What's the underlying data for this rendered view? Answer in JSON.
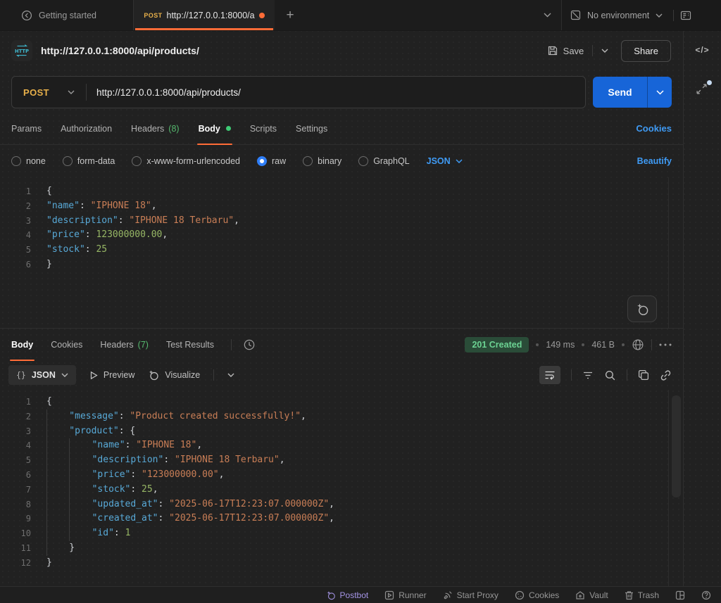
{
  "topbar": {
    "tab_getting_started": "Getting started",
    "active_tab": {
      "method": "POST",
      "title": "http://127.0.0.1:8000/a"
    },
    "new_tab": "+",
    "environment": "No environment"
  },
  "request_header": {
    "title": "http://127.0.0.1:8000/api/products/",
    "save": "Save",
    "share": "Share",
    "code_icon": "</>"
  },
  "url_bar": {
    "method": "POST",
    "url": "http://127.0.0.1:8000/api/products/",
    "send": "Send"
  },
  "request_tabs": {
    "items": [
      {
        "label": "Params"
      },
      {
        "label": "Authorization"
      },
      {
        "label": "Headers",
        "count": "(8)"
      },
      {
        "label": "Body",
        "active": true,
        "dot": true
      },
      {
        "label": "Scripts"
      },
      {
        "label": "Settings"
      }
    ],
    "cookies_link": "Cookies"
  },
  "body_modes": {
    "options": [
      {
        "label": "none"
      },
      {
        "label": "form-data"
      },
      {
        "label": "x-www-form-urlencoded"
      },
      {
        "label": "raw",
        "selected": true
      },
      {
        "label": "binary"
      },
      {
        "label": "GraphQL"
      }
    ],
    "language": "JSON",
    "beautify": "Beautify"
  },
  "request_body": {
    "lines": [
      {
        "ind": 0,
        "tok": [
          [
            "p",
            "{"
          ]
        ]
      },
      {
        "ind": 0,
        "tok": [
          [
            "k",
            "\"name\""
          ],
          [
            "p",
            ": "
          ],
          [
            "s",
            "\"IPHONE 18\""
          ],
          [
            "p",
            ","
          ]
        ]
      },
      {
        "ind": 0,
        "tok": [
          [
            "k",
            "\"description\""
          ],
          [
            "p",
            ": "
          ],
          [
            "s",
            "\"IPHONE 18 Terbaru\""
          ],
          [
            "p",
            ","
          ]
        ]
      },
      {
        "ind": 0,
        "tok": [
          [
            "k",
            "\"price\""
          ],
          [
            "p",
            ": "
          ],
          [
            "n",
            "123000000.00"
          ],
          [
            "p",
            ","
          ]
        ]
      },
      {
        "ind": 0,
        "tok": [
          [
            "k",
            "\"stock\""
          ],
          [
            "p",
            ": "
          ],
          [
            "n",
            "25"
          ]
        ]
      },
      {
        "ind": 0,
        "tok": [
          [
            "p",
            "}"
          ]
        ]
      }
    ]
  },
  "response": {
    "tabs": [
      {
        "label": "Body",
        "active": true
      },
      {
        "label": "Cookies"
      },
      {
        "label": "Headers",
        "count": "(7)"
      },
      {
        "label": "Test Results"
      }
    ],
    "status_badge": "201 Created",
    "time": "149 ms",
    "size": "461 B",
    "view": {
      "brace": "{}",
      "label": "JSON"
    },
    "preview": "Preview",
    "visualize": "Visualize",
    "lines": [
      {
        "ind": 0,
        "tok": [
          [
            "p",
            "{"
          ]
        ]
      },
      {
        "ind": 1,
        "tok": [
          [
            "k",
            "\"message\""
          ],
          [
            "p",
            ": "
          ],
          [
            "s",
            "\"Product created successfully!\""
          ],
          [
            "p",
            ","
          ]
        ]
      },
      {
        "ind": 1,
        "tok": [
          [
            "k",
            "\"product\""
          ],
          [
            "p",
            ": "
          ],
          [
            "p",
            "{"
          ]
        ]
      },
      {
        "ind": 2,
        "tok": [
          [
            "k",
            "\"name\""
          ],
          [
            "p",
            ": "
          ],
          [
            "s",
            "\"IPHONE 18\""
          ],
          [
            "p",
            ","
          ]
        ]
      },
      {
        "ind": 2,
        "tok": [
          [
            "k",
            "\"description\""
          ],
          [
            "p",
            ": "
          ],
          [
            "s",
            "\"IPHONE 18 Terbaru\""
          ],
          [
            "p",
            ","
          ]
        ]
      },
      {
        "ind": 2,
        "tok": [
          [
            "k",
            "\"price\""
          ],
          [
            "p",
            ": "
          ],
          [
            "s",
            "\"123000000.00\""
          ],
          [
            "p",
            ","
          ]
        ]
      },
      {
        "ind": 2,
        "tok": [
          [
            "k",
            "\"stock\""
          ],
          [
            "p",
            ": "
          ],
          [
            "n",
            "25"
          ],
          [
            "p",
            ","
          ]
        ]
      },
      {
        "ind": 2,
        "tok": [
          [
            "k",
            "\"updated_at\""
          ],
          [
            "p",
            ": "
          ],
          [
            "s",
            "\"2025-06-17T12:23:07.000000Z\""
          ],
          [
            "p",
            ","
          ]
        ]
      },
      {
        "ind": 2,
        "tok": [
          [
            "k",
            "\"created_at\""
          ],
          [
            "p",
            ": "
          ],
          [
            "s",
            "\"2025-06-17T12:23:07.000000Z\""
          ],
          [
            "p",
            ","
          ]
        ]
      },
      {
        "ind": 2,
        "tok": [
          [
            "k",
            "\"id\""
          ],
          [
            "p",
            ": "
          ],
          [
            "n",
            "1"
          ]
        ]
      },
      {
        "ind": 1,
        "tok": [
          [
            "p",
            "}"
          ]
        ]
      },
      {
        "ind": 0,
        "tok": [
          [
            "p",
            "}"
          ]
        ]
      }
    ]
  },
  "statusbar": {
    "items": [
      {
        "label": "Postbot",
        "icon": "postbot",
        "accent": true
      },
      {
        "label": "Runner",
        "icon": "runner"
      },
      {
        "label": "Start Proxy",
        "icon": "proxy"
      },
      {
        "label": "Cookies",
        "icon": "cookie"
      },
      {
        "label": "Vault",
        "icon": "vault"
      },
      {
        "label": "Trash",
        "icon": "trash"
      }
    ]
  },
  "colors": {
    "accent_orange": "#ff6c37",
    "method_yellow": "#e8b04a",
    "link_blue": "#3f9bf5",
    "send_blue": "#1765d8",
    "success_green": "#6cd393",
    "count_green": "#55b96e",
    "postbot_purple": "#a494e4"
  }
}
